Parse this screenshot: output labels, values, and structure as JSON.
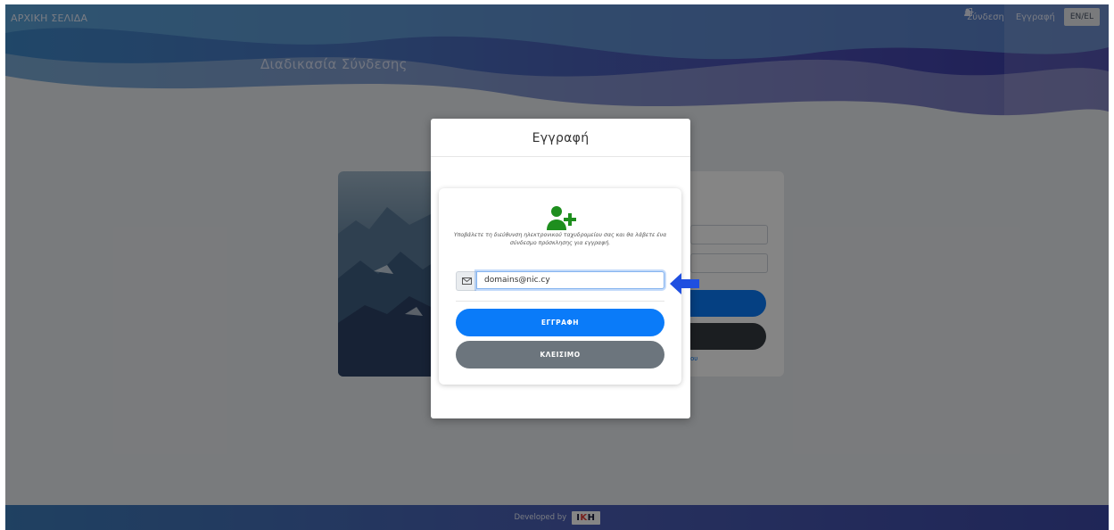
{
  "header": {
    "home_label": "ΑΡΧΙΚΗ ΣΕΛΙΔΑ",
    "login_label": "Σύνδεση",
    "register_label": "Εγγραφή",
    "lang_label": "EN/EL",
    "page_title": "Διαδικασία Σύνδεσης"
  },
  "footer": {
    "developed_by": "Developed by",
    "logo_part1": "I",
    "logo_part2": "K",
    "logo_part3": "H"
  },
  "modal": {
    "title": "Εγγραφή",
    "instructions": "Υποβάλετε τη διεύθυνση ηλεκτρονικού ταχυδρομείου σας και θα λάβετε ένα σύνδεσμο πρόσκλησης για εγγραφή.",
    "email_value": "domains@nic.cy",
    "register_button": "ΕΓΓΡΑΦΗ",
    "close_button": "ΚΛΕΙΣΙΜΟ"
  },
  "background_card": {
    "link_fragment": "ου"
  },
  "colors": {
    "primary": "#0a7bf9",
    "secondary": "#6c757d",
    "success_icon": "#1e8e1e",
    "arrow": "#1f4fe0"
  },
  "icons": [
    "sign-in-icon",
    "user-plus-icon",
    "envelope-icon",
    "arrow-left-icon"
  ]
}
